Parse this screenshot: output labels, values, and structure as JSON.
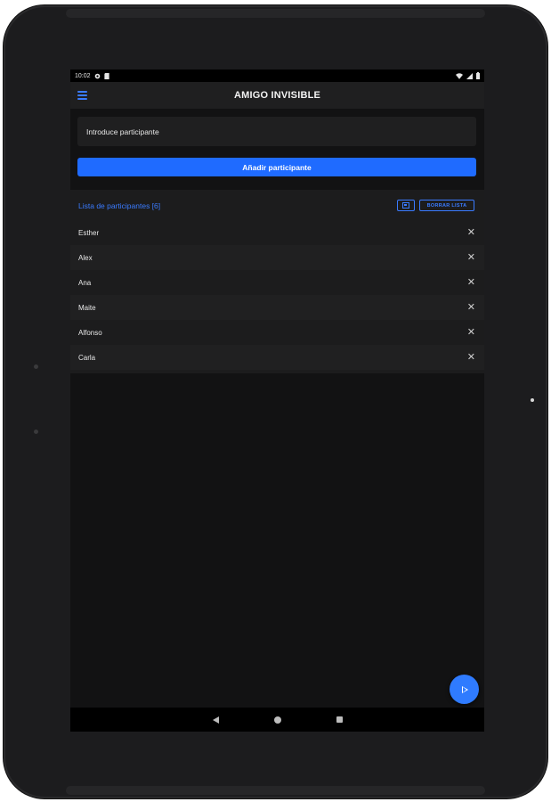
{
  "status_bar": {
    "time": "10:02",
    "left_icons": [
      "settings-icon",
      "sd-card-icon"
    ],
    "right_icons": [
      "wifi-icon",
      "signal-icon",
      "battery-icon"
    ]
  },
  "app_bar": {
    "title": "AMIGO INVISIBLE",
    "menu_icon": "hamburger-menu-icon"
  },
  "input": {
    "placeholder": "Introduce participante"
  },
  "add_button": {
    "label": "Añadir participante",
    "color": "#1f6bff"
  },
  "participants": {
    "title": "Lista de participantes [6]",
    "save_icon": "save-icon",
    "clear_label": "BORRAR LISTA",
    "items": [
      {
        "name": "Esther"
      },
      {
        "name": "Alex"
      },
      {
        "name": "Ana"
      },
      {
        "name": "Maite"
      },
      {
        "name": "Alfonso"
      },
      {
        "name": "Carla"
      }
    ],
    "remove_icon": "close-icon",
    "remove_glyph": "✕"
  },
  "fab": {
    "icon": "play-icon",
    "color": "#2f7bff"
  },
  "nav_bar": {
    "icons": [
      "back-icon",
      "home-icon",
      "recents-icon"
    ]
  },
  "accent_color": "#3a7bff"
}
